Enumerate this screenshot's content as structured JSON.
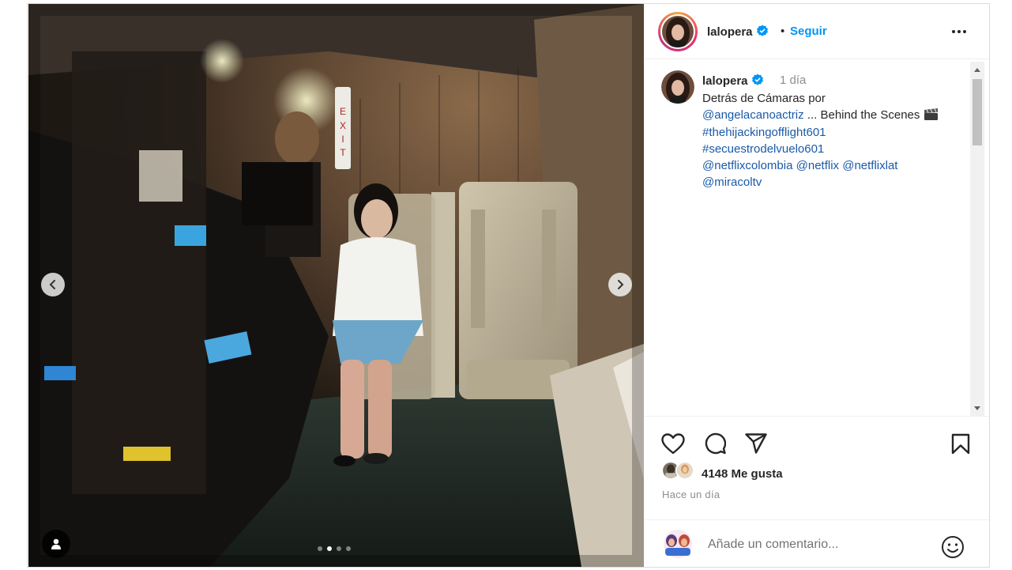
{
  "post": {
    "username": "lalopera",
    "follow_label": "Seguir",
    "separator": "•",
    "caption": {
      "username": "lalopera",
      "time": "1 día",
      "line1": "Detrás de Cámaras por",
      "mention1": "@angelacanoactriz",
      "after_mention1": " ... Behind the Scenes ",
      "hashtag1": "#thehijackingofflight601",
      "hashtag2": "#secuestrodelvuelo601",
      "mention2": "@netflixcolombia",
      "mention3": "@netflix",
      "mention4": "@netflixlat",
      "mention5": "@miracoltv"
    },
    "likes": "4148 Me gusta",
    "posted": "Hace un día",
    "comment_placeholder": "Añade un comentario..."
  },
  "carousel": {
    "slide_count": 4,
    "active_index": 1
  },
  "icons": {
    "verified": "verified-badge-icon",
    "more": "more-options-icon",
    "like": "heart-icon",
    "comment": "comment-bubble-icon",
    "share": "paper-plane-icon",
    "save": "bookmark-icon",
    "emoji": "emoji-icon",
    "tag": "user-tag-icon",
    "clapper": "clapperboard-icon"
  },
  "colors": {
    "link": "#1a5aa8",
    "follow": "#0095f6",
    "verified": "#0095f6",
    "text": "#262626",
    "muted": "#8e8e8e"
  }
}
